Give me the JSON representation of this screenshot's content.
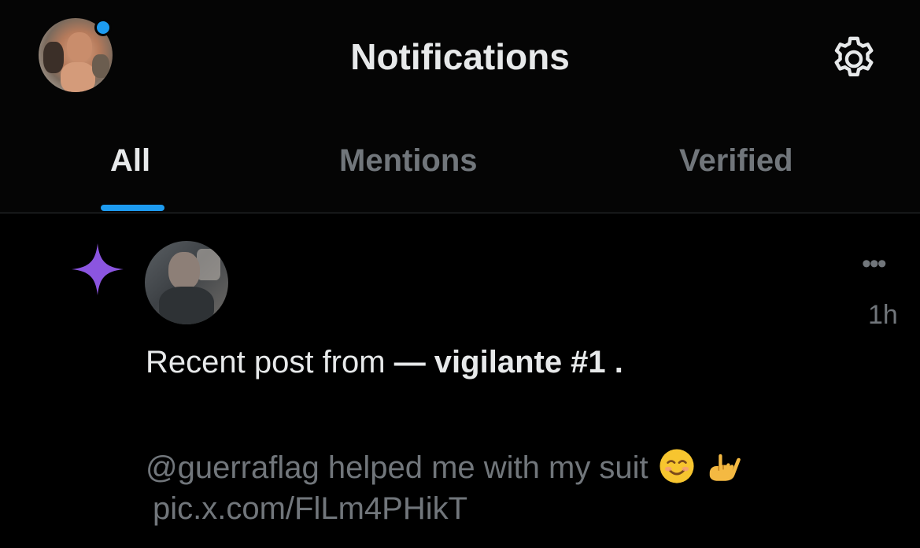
{
  "header": {
    "title": "Notifications",
    "has_unread_indicator": true,
    "accent_color": "#1d9bf0"
  },
  "tabs": [
    {
      "label": "All",
      "active": true
    },
    {
      "label": "Mentions",
      "active": false
    },
    {
      "label": "Verified",
      "active": false
    }
  ],
  "notification": {
    "type_icon": "sparkle-icon",
    "type_icon_color": "#8b55e0",
    "time": "1h",
    "more_label": "•••",
    "intro": "Recent post from ",
    "author": "— vigilante #1",
    "intro_end": " .",
    "post_text": "@guerraflag helped me with my suit",
    "post_emojis": [
      "smiling-face-icon",
      "call-me-hand-icon"
    ],
    "post_link": "pic.x.com/FlLm4PHikT"
  }
}
